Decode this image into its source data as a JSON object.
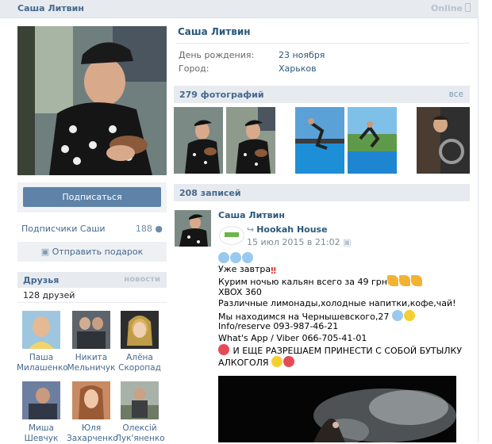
{
  "header": {
    "name": "Саша Литвин",
    "status": "Online"
  },
  "left": {
    "subscribe_label": "Подписаться",
    "followers_label": "Подписчики Саши",
    "followers_count": "188",
    "gift_label": "Отправить подарок",
    "friends": {
      "title": "Друзья",
      "news_link": "новости",
      "count_text": "128 друзей",
      "items": [
        {
          "line1": "Паша",
          "line2": "Милашенко"
        },
        {
          "line1": "Никита",
          "line2": "Мельничук"
        },
        {
          "line1": "Алёна",
          "line2": "Скоропад"
        },
        {
          "line1": "Миша",
          "line2": "Шевчук"
        },
        {
          "line1": "Юля",
          "line2": "Захарченко"
        },
        {
          "line1": "Олексій",
          "line2": "Лук'яненко"
        }
      ]
    }
  },
  "profile": {
    "name": "Саша Литвин",
    "birthday_label": "День рождения:",
    "birthday_value": "23 ноября",
    "city_label": "Город:",
    "city_value": "Харьков"
  },
  "photos": {
    "title": "279 фотографий",
    "all_link": "все"
  },
  "wall": {
    "title": "208 записей"
  },
  "post": {
    "author": "Саша Литвин",
    "repost_name": "Hookah House",
    "repost_date": "15 июл 2015 в 21:02",
    "lines": [
      "Уже завтра",
      "Курим ночью кальян всего за 49 грн",
      "XBOX 360",
      "Различные лимонады,холодные напитки,кофе,чай!",
      "Мы находимся на Чернышевского,27",
      "Info/reserve 093-987-46-21",
      "What's App / Viber 066-705-41-01",
      "И ЕЩЕ РАЗРЕШАЕМ ПРИНЕСТИ С СОБОЙ БУТЫЛКУ",
      "АЛКОГОЛЯ"
    ]
  },
  "colors": {
    "link": "#2b587a",
    "header_bg": "#e7ebf0",
    "button": "#5e82a8"
  }
}
